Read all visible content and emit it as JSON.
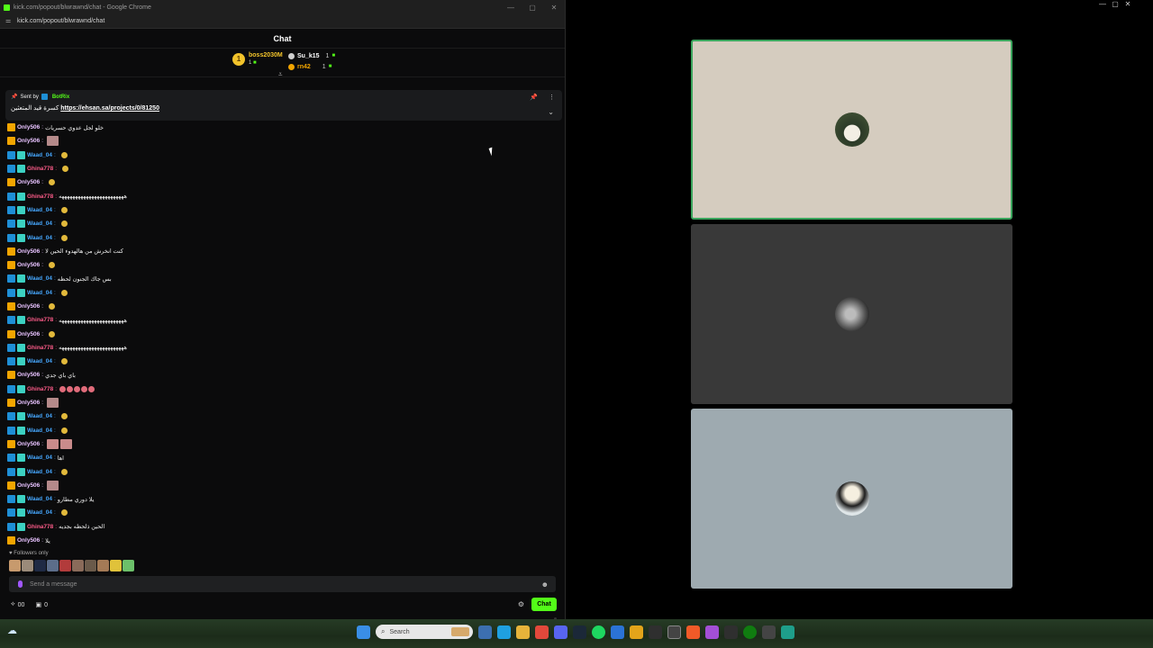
{
  "window": {
    "title": "kick.com/popout/blwrawnd/chat - Google Chrome",
    "url": "kick.com/popout/blwrawnd/chat"
  },
  "chat": {
    "header": "Chat",
    "leaderboard": {
      "first": {
        "rank": "1",
        "name": "boss2030M",
        "count": "1"
      },
      "others": [
        {
          "name": "Su_k15",
          "count": "1",
          "color": "#ffffff"
        },
        {
          "name": "rn42",
          "count": "1",
          "color": "#f2a500"
        }
      ]
    },
    "pinned": {
      "sent_by_label": "Sent by",
      "bot_name": "BotRix",
      "prefix": "كسرة قيد المتعثين",
      "link": "https://ehsan.sa/projects/0/81250"
    },
    "messages": [
      {
        "user": "Only506",
        "color": "#e8c2ff",
        "badges": [
          "og"
        ],
        "text": "خلو لجل عدوي حسريات"
      },
      {
        "user": "Only506",
        "color": "#e8c2ff",
        "badges": [
          "og"
        ],
        "text": "",
        "emote": "img"
      },
      {
        "user": "Waad_04",
        "color": "#46a8ff",
        "badges": [
          "mod",
          "vip"
        ],
        "text": "",
        "emote": "dot"
      },
      {
        "user": "Ghina778",
        "color": "#ff5c8a",
        "badges": [
          "mod",
          "vip"
        ],
        "text": "",
        "emote": "dot"
      },
      {
        "user": "Only506",
        "color": "#e8c2ff",
        "badges": [
          "og"
        ],
        "text": "",
        "emote": "dot"
      },
      {
        "user": "Ghina778",
        "color": "#ff5c8a",
        "badges": [
          "mod",
          "vip"
        ],
        "text": "ههههههههههههههههههههههههه"
      },
      {
        "user": "Waad_04",
        "color": "#46a8ff",
        "badges": [
          "mod",
          "vip"
        ],
        "text": "",
        "emote": "dot"
      },
      {
        "user": "Waad_04",
        "color": "#46a8ff",
        "badges": [
          "mod",
          "vip"
        ],
        "text": "",
        "emote": "dot"
      },
      {
        "user": "Waad_04",
        "color": "#46a8ff",
        "badges": [
          "mod",
          "vip"
        ],
        "text": "",
        "emote": "dot"
      },
      {
        "user": "Only506",
        "color": "#e8c2ff",
        "badges": [
          "og"
        ],
        "text": "كنت انخرش من هالهدوء الحين لا"
      },
      {
        "user": "Only506",
        "color": "#e8c2ff",
        "badges": [
          "og"
        ],
        "text": "",
        "emote": "dot"
      },
      {
        "user": "Waad_04",
        "color": "#46a8ff",
        "badges": [
          "mod",
          "vip"
        ],
        "text": "بس جاك الجنون لحظه"
      },
      {
        "user": "Waad_04",
        "color": "#46a8ff",
        "badges": [
          "mod",
          "vip"
        ],
        "text": "",
        "emote": "dot"
      },
      {
        "user": "Only506",
        "color": "#e8c2ff",
        "badges": [
          "og"
        ],
        "text": "",
        "emote": "dot"
      },
      {
        "user": "Ghina778",
        "color": "#ff5c8a",
        "badges": [
          "mod",
          "vip"
        ],
        "text": "ههههههههههههههههههههههههه"
      },
      {
        "user": "Only506",
        "color": "#e8c2ff",
        "badges": [
          "og"
        ],
        "text": "",
        "emote": "dot"
      },
      {
        "user": "Ghina778",
        "color": "#ff5c8a",
        "badges": [
          "mod",
          "vip"
        ],
        "text": "ههههههههههههههههههههههههه"
      },
      {
        "user": "Waad_04",
        "color": "#46a8ff",
        "badges": [
          "mod",
          "vip"
        ],
        "text": "",
        "emote": "dot"
      },
      {
        "user": "Only506",
        "color": "#e8c2ff",
        "badges": [
          "og"
        ],
        "text": "باي باي جدي"
      },
      {
        "user": "Ghina778",
        "color": "#ff5c8a",
        "badges": [
          "mod",
          "vip"
        ],
        "text": "",
        "emote": "multi"
      },
      {
        "user": "Only506",
        "color": "#e8c2ff",
        "badges": [
          "og"
        ],
        "text": "",
        "emote": "img"
      },
      {
        "user": "Waad_04",
        "color": "#46a8ff",
        "badges": [
          "mod",
          "vip"
        ],
        "text": "",
        "emote": "dot"
      },
      {
        "user": "Waad_04",
        "color": "#46a8ff",
        "badges": [
          "mod",
          "vip"
        ],
        "text": "",
        "emote": "dot"
      },
      {
        "user": "Only506",
        "color": "#e8c2ff",
        "badges": [
          "og"
        ],
        "text": "",
        "emote": "img2"
      },
      {
        "user": "Waad_04",
        "color": "#46a8ff",
        "badges": [
          "mod",
          "vip"
        ],
        "text": "اها"
      },
      {
        "user": "Waad_04",
        "color": "#46a8ff",
        "badges": [
          "mod",
          "vip"
        ],
        "text": "",
        "emote": "dot"
      },
      {
        "user": "Only506",
        "color": "#e8c2ff",
        "badges": [
          "og"
        ],
        "text": "",
        "emote": "img"
      },
      {
        "user": "Waad_04",
        "color": "#46a8ff",
        "badges": [
          "mod",
          "vip"
        ],
        "text": "يلا دوري مطارو"
      },
      {
        "user": "Waad_04",
        "color": "#46a8ff",
        "badges": [
          "mod",
          "vip"
        ],
        "text": "",
        "emote": "dot"
      },
      {
        "user": "Ghina778",
        "color": "#ff5c8a",
        "badges": [
          "mod",
          "vip"
        ],
        "text": "الحين ذلحظه بجديه"
      },
      {
        "user": "Only506",
        "color": "#e8c2ff",
        "badges": [
          "og"
        ],
        "text": "يلا"
      }
    ],
    "followers_only": "Followers only",
    "input_placeholder": "Send a message",
    "points": "00",
    "gifts": "0",
    "send_button": "Chat"
  },
  "taskbar": {
    "search_placeholder": "Search"
  },
  "colors": {
    "kick_green": "#53fc18",
    "speaking_border": "#3ba55d"
  }
}
